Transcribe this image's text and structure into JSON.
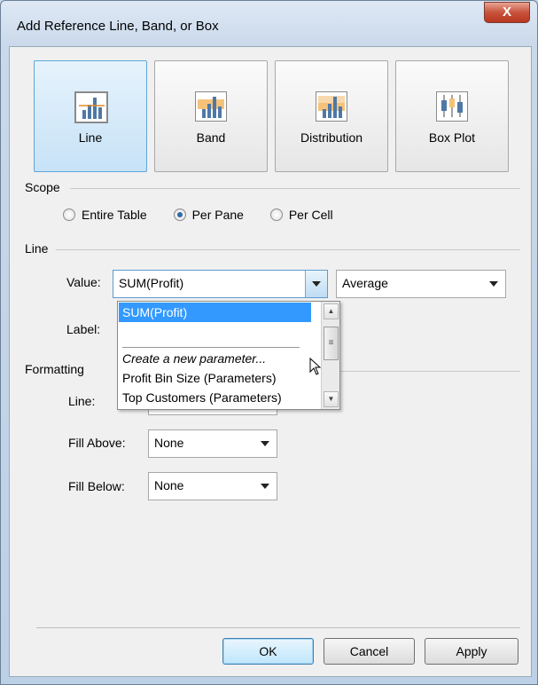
{
  "window": {
    "title": "Add Reference Line, Band, or Box",
    "close_glyph": "X"
  },
  "types": [
    {
      "label": "Line",
      "selected": true,
      "icon": "reference-line-icon"
    },
    {
      "label": "Band",
      "selected": false,
      "icon": "reference-band-icon"
    },
    {
      "label": "Distribution",
      "selected": false,
      "icon": "distribution-icon"
    },
    {
      "label": "Box Plot",
      "selected": false,
      "icon": "box-plot-icon"
    }
  ],
  "scope": {
    "heading": "Scope",
    "options": [
      {
        "label": "Entire Table",
        "checked": false
      },
      {
        "label": "Per Pane",
        "checked": true
      },
      {
        "label": "Per Cell",
        "checked": false
      }
    ]
  },
  "line": {
    "heading": "Line",
    "value_label": "Value:",
    "value_selected": "SUM(Profit)",
    "aggregation": "Average",
    "label_label": "Label:",
    "dropdown_items": [
      {
        "text": "SUM(Profit)",
        "highlighted": true,
        "italic": false
      },
      {
        "text": "Create a new parameter...",
        "highlighted": false,
        "italic": true
      },
      {
        "text": "Profit Bin Size (Parameters)",
        "highlighted": false,
        "italic": false
      },
      {
        "text": "Top Customers (Parameters)",
        "highlighted": false,
        "italic": false
      }
    ]
  },
  "formatting": {
    "heading": "Formatting",
    "line_label": "Line:",
    "fill_above_label": "Fill Above:",
    "fill_above_value": "None",
    "fill_below_label": "Fill Below:",
    "fill_below_value": "None"
  },
  "buttons": {
    "ok": "OK",
    "cancel": "Cancel",
    "apply": "Apply"
  },
  "colors": {
    "accent": "#3399ff",
    "selected_tile": "#c7e2f7",
    "bar_blue": "#4e79a7",
    "band_orange": "#f5c27a"
  }
}
